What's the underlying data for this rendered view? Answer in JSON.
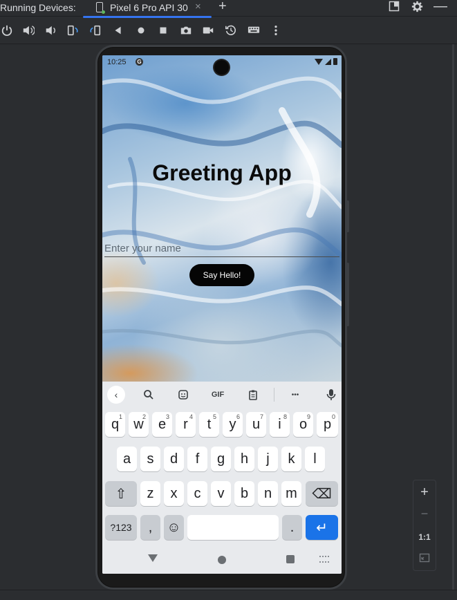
{
  "ide": {
    "panel_title": "Running Devices:",
    "tab_label": "Pixel 6 Pro API 30",
    "tab_close": "×",
    "add_tab": "+",
    "zoom": {
      "in": "+",
      "out": "−",
      "actual": "1:1"
    }
  },
  "status_bar": {
    "time": "10:25",
    "notification_badge": "G"
  },
  "app": {
    "title": "Greeting App",
    "name_placeholder": "Enter your name",
    "button_label": "Say Hello!"
  },
  "keyboard": {
    "toolbar": {
      "gif": "GIF",
      "more": "•••"
    },
    "row1": [
      {
        "k": "q",
        "n": "1"
      },
      {
        "k": "w",
        "n": "2"
      },
      {
        "k": "e",
        "n": "3"
      },
      {
        "k": "r",
        "n": "4"
      },
      {
        "k": "t",
        "n": "5"
      },
      {
        "k": "y",
        "n": "6"
      },
      {
        "k": "u",
        "n": "7"
      },
      {
        "k": "i",
        "n": "8"
      },
      {
        "k": "o",
        "n": "9"
      },
      {
        "k": "p",
        "n": "0"
      }
    ],
    "row2": [
      "a",
      "s",
      "d",
      "f",
      "g",
      "h",
      "j",
      "k",
      "l"
    ],
    "row3": [
      "z",
      "x",
      "c",
      "v",
      "b",
      "n",
      "m"
    ],
    "symbols": "?123",
    "comma": ",",
    "period": ".",
    "shift_icon": "⇧",
    "backspace_icon": "⌫",
    "emoji_icon": "☺",
    "enter_icon": "↵"
  },
  "colors": {
    "accent": "#3574f0",
    "enter_key": "#1a73e8",
    "button": "#050505"
  }
}
